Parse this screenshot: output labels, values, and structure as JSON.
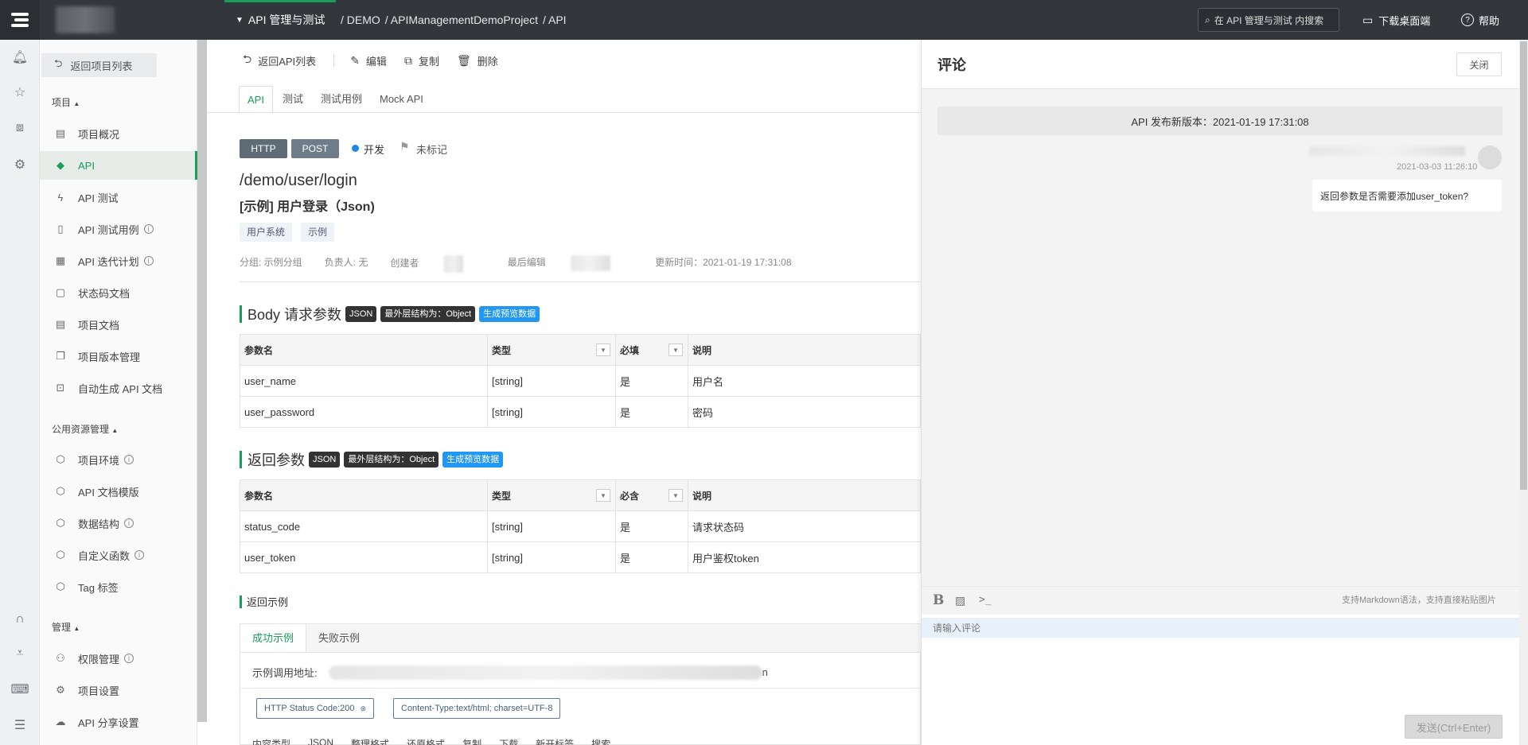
{
  "topbar": {
    "module": "API 管理与测试",
    "breadcrumb": [
      "/ DEMO",
      "/ APIManagementDemoProject",
      "/ API"
    ],
    "search_placeholder": "在 API 管理与测试 内搜索",
    "download_label": "下载桌面端",
    "help_label": "帮助"
  },
  "rail": {
    "icons": [
      "bell-icon",
      "star-icon",
      "box-icon",
      "settings-icon",
      "headset-icon",
      "download-icon",
      "keyboard-icon",
      "menu-icon"
    ]
  },
  "sidebar": {
    "back_label": "返回项目列表",
    "section_project": "项目",
    "section_public": "公用资源管理",
    "section_admin": "管理",
    "project_items": [
      {
        "label": "项目概况",
        "icon": "overview-icon",
        "glyph": "▤"
      },
      {
        "label": "API",
        "icon": "api-icon",
        "glyph": "◆"
      },
      {
        "label": "API 测试",
        "icon": "test-icon",
        "glyph": "ϟ"
      },
      {
        "label": "API 测试用例",
        "icon": "testcase-icon",
        "glyph": "▯"
      },
      {
        "label": "API 迭代计划",
        "icon": "plan-icon",
        "glyph": "▦"
      },
      {
        "label": "状态码文档",
        "icon": "statuscode-icon",
        "glyph": "▢"
      },
      {
        "label": "项目文档",
        "icon": "doc-icon",
        "glyph": "▤"
      },
      {
        "label": "项目版本管理",
        "icon": "version-icon",
        "glyph": "❐"
      },
      {
        "label": "自动生成 API 文档",
        "icon": "robot-icon",
        "glyph": "⊡"
      }
    ],
    "public_items": [
      {
        "label": "项目环境",
        "icon": "env-icon",
        "glyph": "⬡"
      },
      {
        "label": "API 文档模版",
        "icon": "template-icon",
        "glyph": "⬡"
      },
      {
        "label": "数据结构",
        "icon": "datastruct-icon",
        "glyph": "⬡"
      },
      {
        "label": "自定义函数",
        "icon": "function-icon",
        "glyph": "⬡"
      },
      {
        "label": "Tag 标签",
        "icon": "tag-icon",
        "glyph": "⬡"
      }
    ],
    "admin_items": [
      {
        "label": "权限管理",
        "icon": "permission-icon",
        "glyph": "⚇"
      },
      {
        "label": "项目设置",
        "icon": "project-settings-icon",
        "glyph": "⚙"
      },
      {
        "label": "API 分享设置",
        "icon": "cloud-icon",
        "glyph": "☁"
      }
    ]
  },
  "toolbar": {
    "back": "返回API列表",
    "edit": "编辑",
    "copy": "复制",
    "delete": "删除"
  },
  "tabs": [
    "API",
    "测试",
    "测试用例",
    "Mock API"
  ],
  "api": {
    "protocol": "HTTP",
    "method": "POST",
    "status": "开发",
    "mark": "未标记",
    "path": "/demo/user/login",
    "name": "[示例] 用户登录（Json)",
    "tags": [
      "用户系统",
      "示例"
    ],
    "meta": {
      "group": "分组: 示例分组",
      "owner": "负责人: 无",
      "creator": "创建者",
      "editor": "最后编辑",
      "updated": "更新时间：2021-01-19 17:31:08"
    }
  },
  "body_params": {
    "title": "Body 请求参数",
    "pill_json": "JSON",
    "pill_struct": "最外层结构为：Object",
    "pill_gen": "生成预览数据",
    "headers": [
      "参数名",
      "类型",
      "必填",
      "说明"
    ],
    "rows": [
      {
        "name": "user_name",
        "type": "[string]",
        "required": "是",
        "desc": "用户名"
      },
      {
        "name": "user_password",
        "type": "[string]",
        "required": "是",
        "desc": "密码"
      }
    ]
  },
  "return_params": {
    "title": "返回参数",
    "pill_json": "JSON",
    "pill_struct": "最外层结构为：Object",
    "pill_gen": "生成预览数据",
    "headers": [
      "参数名",
      "类型",
      "必含",
      "说明"
    ],
    "rows": [
      {
        "name": "status_code",
        "type": "[string]",
        "required": "是",
        "desc": "请求状态码"
      },
      {
        "name": "user_token",
        "type": "[string]",
        "required": "是",
        "desc": "用户鉴权token"
      }
    ]
  },
  "example": {
    "title": "返回示例",
    "tabs": [
      "成功示例",
      "失败示例"
    ],
    "url_label": "示例调用地址:",
    "url_tail": "n",
    "status_badge": "HTTP Status Code:200",
    "content_type_badge": "Content-Type:text/html; charset=UTF-8",
    "tools": [
      "内容类型",
      "JSON",
      "整理格式",
      "还原格式",
      "复制",
      "下载",
      "新开标签",
      "搜索"
    ]
  },
  "comments": {
    "title": "评论",
    "close_label": "关闭",
    "release_notice": "API 发布新版本：2021-01-19 17:31:08",
    "comment_time": "2021-03-03 11:26:10",
    "comment_text": "返回参数是否需要添加user_token?",
    "hint": "支持Markdown语法，支持直接粘贴图片",
    "input_placeholder": "请输入评论",
    "send_label": "发送(Ctrl+Enter)"
  }
}
